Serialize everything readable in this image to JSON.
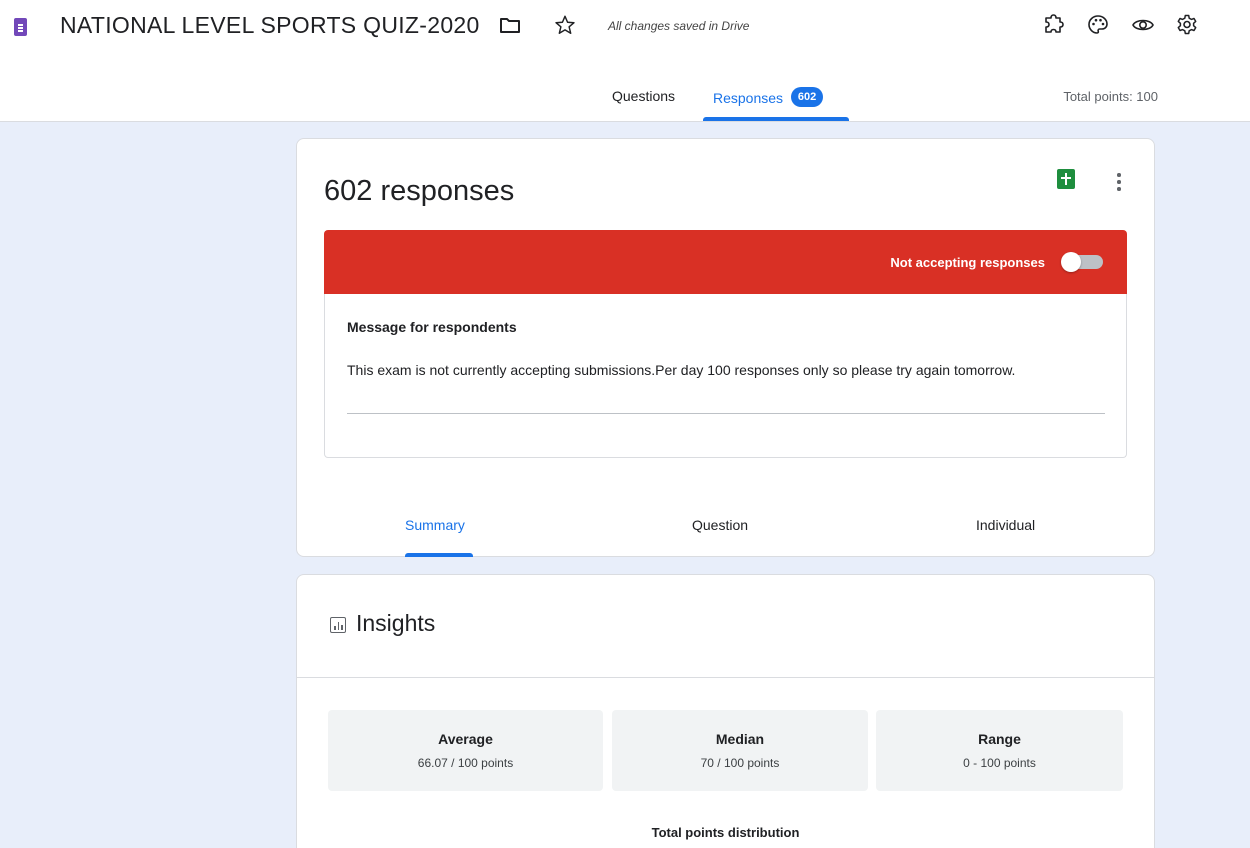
{
  "header": {
    "title": "NATIONAL LEVEL SPORTS QUIZ-2020",
    "save_status": "All changes saved in Drive",
    "icons": [
      "forms-logo-icon",
      "folder-icon",
      "star-icon",
      "addon-puzzle-icon",
      "palette-icon",
      "eye-preview-icon",
      "gear-icon"
    ]
  },
  "tabs": {
    "questions": "Questions",
    "responses": "Responses",
    "responses_count": "602",
    "total_points": "Total points: 100",
    "active": "Responses"
  },
  "responses_card": {
    "heading": "602 responses",
    "accepting_label": "Not accepting responses",
    "accepting_responses": false,
    "banner_color": "#d93025",
    "message_label": "Message for respondents",
    "message_text": "This exam is not currently accepting submissions.Per day 100 responses only so please try again tomorrow.",
    "sub_tabs": [
      "Summary",
      "Question",
      "Individual"
    ],
    "active_sub_tab": "Summary"
  },
  "insights": {
    "title": "Insights",
    "stats": [
      {
        "label": "Average",
        "value": "66.07 / 100 points"
      },
      {
        "label": "Median",
        "value": "70 / 100 points"
      },
      {
        "label": "Range",
        "value": "0 - 100 points"
      }
    ],
    "distribution_title": "Total points distribution"
  },
  "colors": {
    "accent": "#1a73e8",
    "background": "#e8eefa",
    "sheets_green": "#1e8e3e",
    "forms_purple": "#7248b9"
  }
}
